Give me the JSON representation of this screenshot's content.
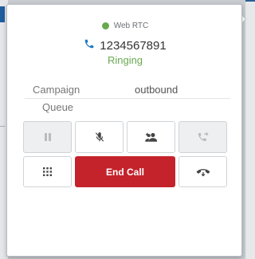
{
  "connection": {
    "label": "Web RTC",
    "color": "#6aa84f"
  },
  "call": {
    "number": "1234567891",
    "status": "Ringing",
    "status_color": "#6aa84f"
  },
  "details": {
    "campaign_label": "Campaign",
    "campaign_value": "outbound",
    "queue_label": "Queue"
  },
  "controls": {
    "hold_icon": "pause-icon",
    "mute_icon": "mic-muted-icon",
    "conference_icon": "add-participant-icon",
    "transfer_icon": "transfer-call-icon",
    "dialpad_icon": "dialpad-icon",
    "end_call_label": "End Call",
    "end_call_color": "#c4232c",
    "hangup_icon": "phone-hangup-icon"
  }
}
